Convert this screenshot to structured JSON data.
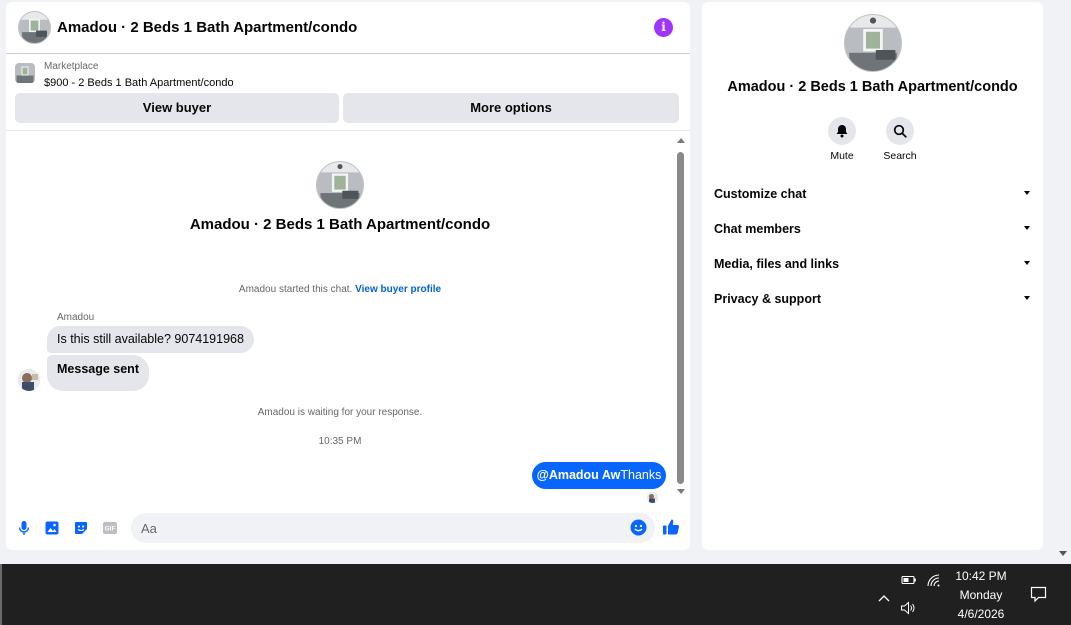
{
  "chat": {
    "title": "Amadou · 2 Beds 1 Bath Apartment/condo",
    "info_icon": "i",
    "marketplace": {
      "label": "Marketplace",
      "item": "$900 - 2 Beds 1 Bath Apartment/condo",
      "view_buyer_label": "View buyer",
      "more_options_label": "More options"
    },
    "thread": {
      "title": "Amadou · 2 Beds 1 Bath Apartment/condo",
      "started_text": "Amadou started this chat.",
      "view_profile_link": "View buyer profile",
      "sender_name": "Amadou",
      "messages_in": [
        "Is this still available? 9074191968",
        "Message sent"
      ],
      "waiting_text": "Amadou is waiting for your response.",
      "timestamp": "10:35 PM",
      "outgoing": {
        "mention": "@Amadou Aw",
        "text": "Thanks"
      }
    },
    "composer": {
      "placeholder": "Aa",
      "tools": [
        "microphone-icon",
        "image-icon",
        "sticker-icon",
        "gif-icon"
      ],
      "gif_label": "GIF"
    },
    "accent_color": "#0866ff"
  },
  "info": {
    "title": "Amadou · 2 Beds 1 Bath Apartment/condo",
    "actions": [
      {
        "label": "Mute",
        "icon": "bell-icon"
      },
      {
        "label": "Search",
        "icon": "search-icon"
      }
    ],
    "menu": [
      "Customize chat",
      "Chat members",
      "Media, files and links",
      "Privacy & support"
    ]
  },
  "taskbar": {
    "time": "10:42 PM",
    "day": "Monday",
    "date": "4/6/2026",
    "tray_icons": [
      "chevron-up-icon",
      "battery-icon",
      "wifi-icon",
      "volume-icon",
      "notification-icon"
    ]
  }
}
